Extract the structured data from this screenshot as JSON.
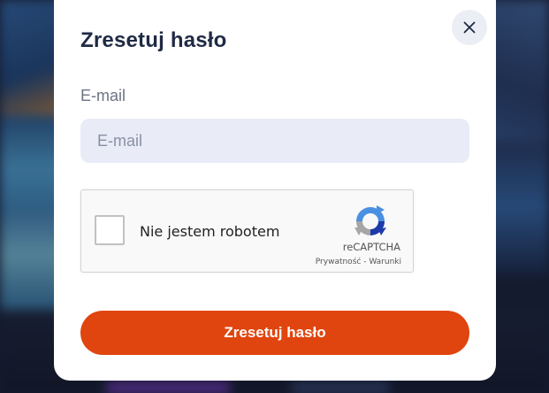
{
  "modal": {
    "title": "Zresetuj hasło",
    "close_icon": "close-icon"
  },
  "email": {
    "label": "E-mail",
    "placeholder": "E-mail",
    "value": ""
  },
  "captcha": {
    "checkbox_label": "Nie jestem robotem",
    "brand": "reCAPTCHA",
    "privacy_link": "Prywatność",
    "separator": " - ",
    "terms_link": "Warunki",
    "logo_icon": "recaptcha-logo-icon"
  },
  "submit": {
    "label": "Zresetuj hasło"
  },
  "colors": {
    "accent": "#e0450f",
    "title": "#1f2a44",
    "input_bg": "#e9ecf7"
  }
}
